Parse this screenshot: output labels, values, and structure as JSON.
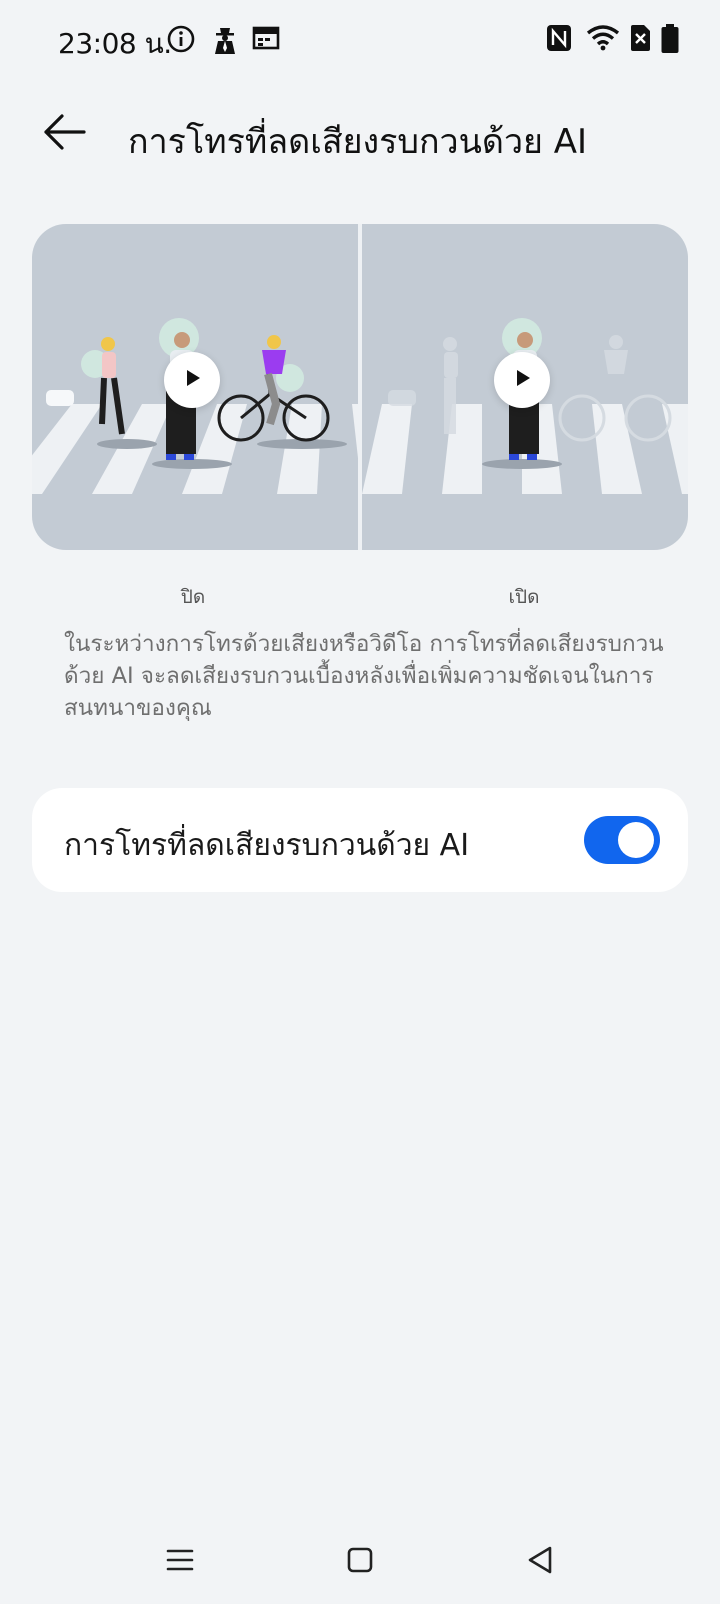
{
  "status_bar": {
    "time": "23:08 น.",
    "left_icons": [
      "info-icon",
      "spy-icon",
      "calendar-icon"
    ],
    "right_icons": [
      "nfc-icon",
      "wifi-icon",
      "sim-off-icon",
      "battery-icon"
    ]
  },
  "header": {
    "back_icon": "arrow-left-icon",
    "title": "การโทรที่ลดเสียงรบกวนด้วย AI"
  },
  "preview": {
    "left_caption": "ปิด",
    "right_caption": "เปิด",
    "play_icon": "play-icon"
  },
  "description": "ในระหว่างการโทรด้วยเสียงหรือวิดีโอ การโทรที่ลดเสียงรบกวนด้วย AI จะลดเสียงรบกวนเบื้องหลังเพื่อเพิ่มความชัดเจนในการสนทนาของคุณ",
  "setting": {
    "label": "การโทรที่ลดเสียงรบกวนด้วย AI",
    "enabled": true
  },
  "navigation": {
    "icons": [
      "menu-icon",
      "home-icon",
      "back-triangle-icon"
    ]
  },
  "colors": {
    "accent": "#1166ee",
    "background": "#f2f4f6",
    "preview_bg": "#c3cbd4"
  }
}
